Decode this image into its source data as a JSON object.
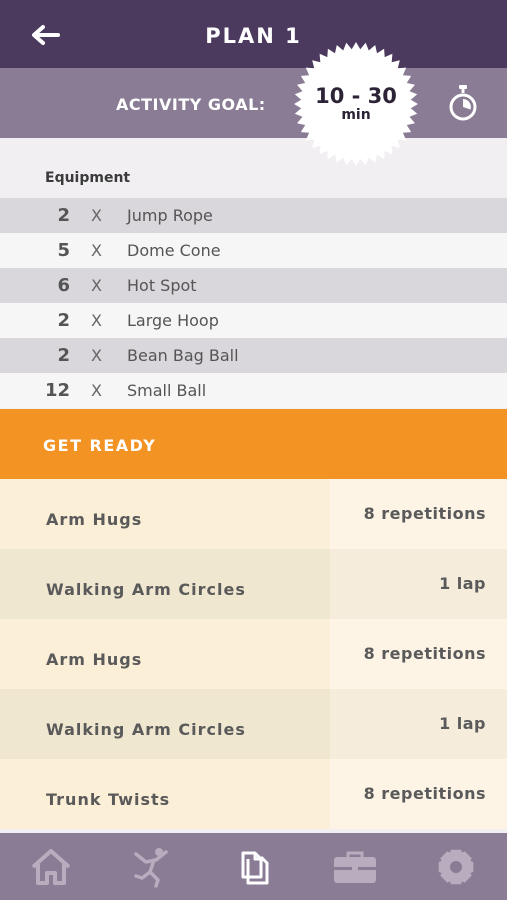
{
  "header": {
    "title": "PLAN 1",
    "back_icon": "back-arrow-icon"
  },
  "goal": {
    "label": "ACTIVITY GOAL:",
    "range": "10 - 30",
    "unit": "min",
    "timer_icon": "stopwatch-icon"
  },
  "equipment": {
    "title": "Equipment",
    "items": [
      {
        "qty": "2",
        "x": "X",
        "name": "Jump Rope"
      },
      {
        "qty": "5",
        "x": "X",
        "name": "Dome Cone"
      },
      {
        "qty": "6",
        "x": "X",
        "name": "Hot Spot"
      },
      {
        "qty": "2",
        "x": "X",
        "name": "Large Hoop"
      },
      {
        "qty": "2",
        "x": "X",
        "name": "Bean Bag Ball"
      },
      {
        "qty": "12",
        "x": "X",
        "name": "Small Ball"
      }
    ]
  },
  "section": {
    "label": "GET READY"
  },
  "activities": [
    {
      "name": "Arm Hugs",
      "amount": "8 repetitions"
    },
    {
      "name": "Walking Arm Circles",
      "amount": "1 lap"
    },
    {
      "name": "Arm Hugs",
      "amount": "8 repetitions"
    },
    {
      "name": "Walking Arm Circles",
      "amount": "1 lap"
    },
    {
      "name": "Trunk Twists",
      "amount": "8 repetitions"
    }
  ],
  "tabbar": {
    "tabs": [
      {
        "icon": "home-icon",
        "active": false
      },
      {
        "icon": "activity-figure-icon",
        "active": false
      },
      {
        "icon": "documents-icon",
        "active": true
      },
      {
        "icon": "briefcase-icon",
        "active": false
      },
      {
        "icon": "gear-icon",
        "active": false
      }
    ]
  },
  "colors": {
    "header_bg": "#4c3a5e",
    "goal_bg": "#8a7c94",
    "accent_orange": "#f39323",
    "tab_inactive": "#b7adbf",
    "tab_active": "#ffffff"
  }
}
